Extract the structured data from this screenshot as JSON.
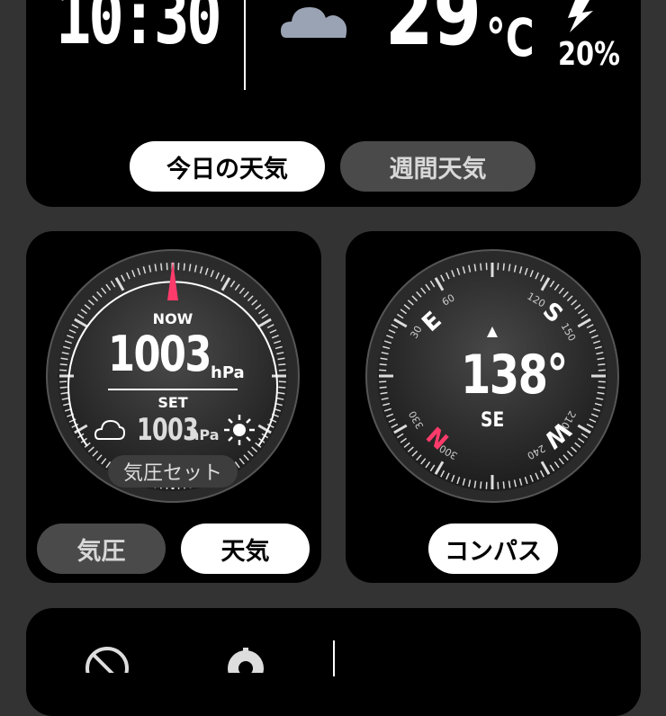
{
  "top": {
    "time": "10:30",
    "temperature": "29",
    "temperature_unit": "°C",
    "precip_percent": "20%",
    "tabs": [
      {
        "label": "今日の天気",
        "active": true
      },
      {
        "label": "週間天気",
        "active": false
      }
    ]
  },
  "barometer": {
    "now_label": "NOW",
    "now_value": "1003",
    "now_unit": "hPa",
    "set_label": "SET",
    "set_value": "1003",
    "set_unit": "hPa",
    "set_button": "気圧セット",
    "tabs": [
      {
        "label": "気圧",
        "active": false
      },
      {
        "label": "天気",
        "active": true
      }
    ]
  },
  "compass": {
    "heading": "138°",
    "direction": "SE",
    "labels": {
      "N": "N",
      "E": "E",
      "S": "S",
      "W": "W"
    },
    "degree_labels": [
      "30",
      "60",
      "120",
      "150",
      "210",
      "240",
      "300",
      "330"
    ],
    "button": "コンパス"
  },
  "colors": {
    "accent_pink": "#ff3b6b",
    "pill_inactive": "#4a4a4a",
    "cloud": "#9aa3b3"
  }
}
